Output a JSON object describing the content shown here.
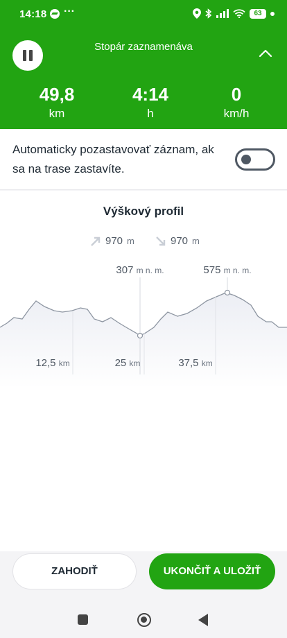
{
  "status_bar": {
    "time": "14:18",
    "dots": "···",
    "battery": "63"
  },
  "header": {
    "title": "Stopár zaznamenáva",
    "stats": [
      {
        "value": "49,8",
        "unit": "km"
      },
      {
        "value": "4:14",
        "unit": "h"
      },
      {
        "value": "0",
        "unit": "km/h"
      }
    ]
  },
  "auto_pause": {
    "text": "Automaticky pozastavovať záznam, ak sa na trase zastavíte.",
    "enabled": false
  },
  "profile": {
    "title": "Výškový profil",
    "ascent": {
      "value": "970",
      "unit": "m"
    },
    "descent": {
      "value": "970",
      "unit": "m"
    },
    "min_label": {
      "value": "307",
      "unit": "m n. m."
    },
    "max_label": {
      "value": "575",
      "unit": "m n. m."
    },
    "distance_ticks": [
      {
        "value": "12,5",
        "unit": "km"
      },
      {
        "value": "25",
        "unit": "km"
      },
      {
        "value": "37,5",
        "unit": "km"
      }
    ]
  },
  "actions": {
    "discard": "ZAHODIŤ",
    "save": "UKONČIŤ A ULOŽIŤ"
  },
  "colors": {
    "accent": "#22a412",
    "text": "#1e2933",
    "muted": "#6b7480"
  }
}
